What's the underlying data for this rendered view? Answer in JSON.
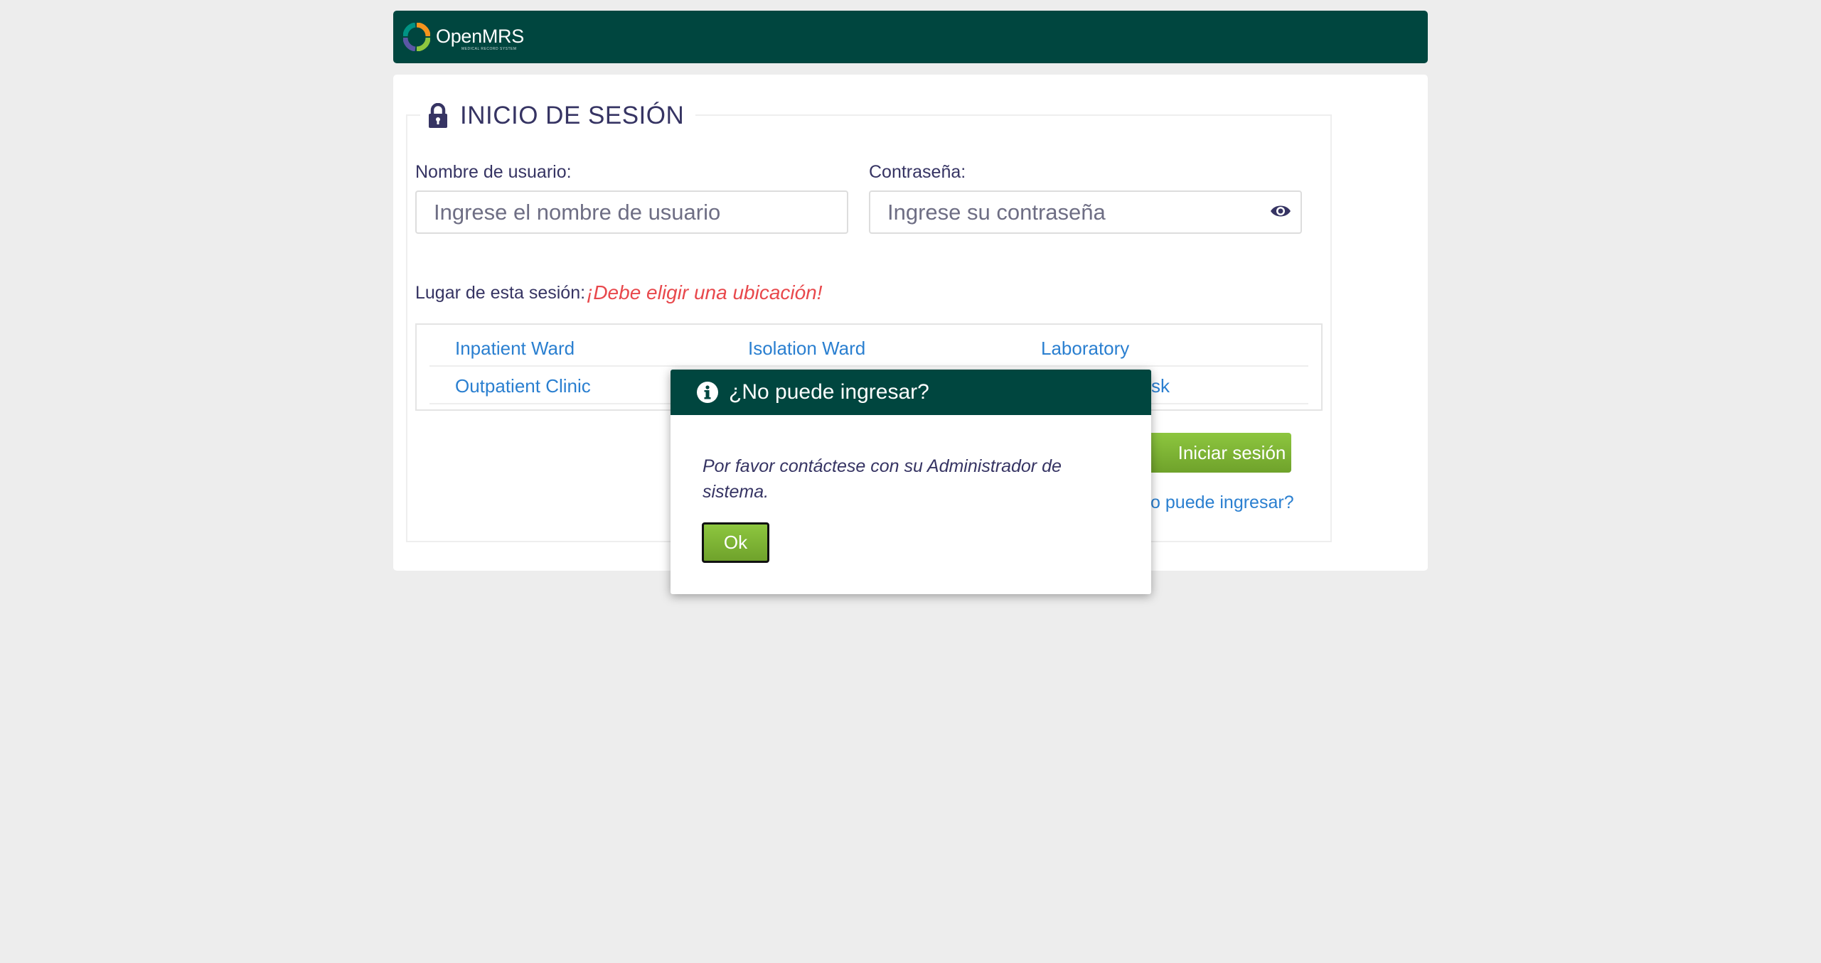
{
  "header": {
    "logo_text": "OpenMRS",
    "logo_subtext": "MEDICAL RECORD SYSTEM"
  },
  "login": {
    "title": "INICIO DE SESIÓN",
    "username_label": "Nombre de usuario:",
    "username_placeholder": "Ingrese el nombre de usuario",
    "username_value": "",
    "password_label": "Contraseña:",
    "password_placeholder": "Ingrese su contraseña",
    "password_value": "",
    "location_label": "Lugar de esta sesión:",
    "location_error": "¡Debe eligir una ubicación!",
    "locations": [
      "Inpatient Ward",
      "Isolation Ward",
      "Laboratory",
      "Outpatient Clinic",
      "",
      "sk"
    ],
    "login_button": "Iniciar sesión",
    "cant_login_link": "No puede ingresar?"
  },
  "dialog": {
    "title": "¿No puede ingresar?",
    "message": "Por favor contáctese con su Administrador de sistema.",
    "ok_button": "Ok"
  },
  "colors": {
    "brand_green": "#00463f",
    "button_green": "#7ab733",
    "link_blue": "#2a7fd0",
    "error_red": "#e8484c",
    "text_dark": "#363463"
  },
  "icons": [
    "openmrs-logo-icon",
    "lock-icon",
    "eye-icon",
    "info-icon"
  ]
}
